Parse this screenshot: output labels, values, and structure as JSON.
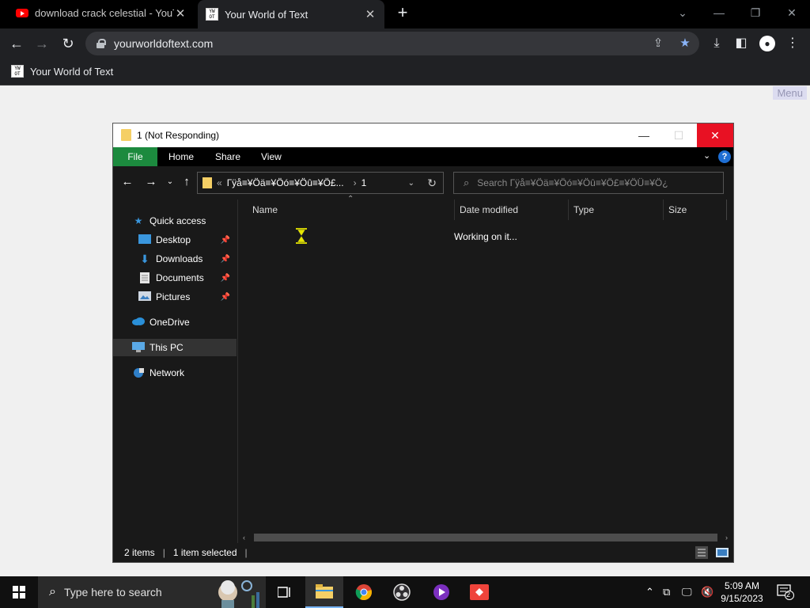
{
  "browser": {
    "tabs": [
      {
        "title": "download crack celestial - YouTube",
        "active": false
      },
      {
        "title": "Your World of Text",
        "active": true
      }
    ],
    "address": "yourworldoftext.com",
    "bookmarks": [
      {
        "label": "Your World of Text"
      }
    ]
  },
  "page": {
    "menu_label": "Menu"
  },
  "explorer": {
    "title": "1 (Not Responding)",
    "ribbon_tabs": [
      "File",
      "Home",
      "Share",
      "View"
    ],
    "address_overflow": "«",
    "address_path": [
      "Гÿå≡¥Öä≡¥Öó≡¥Öû≡¥Ö£...",
      "1"
    ],
    "search_placeholder": "Search Гÿå≡¥Öä≡¥Öó≡¥Öû≡¥Ö£≡¥ÖÜ≡¥Ö¿",
    "nav_items": [
      {
        "label": "Quick access",
        "icon": "star-icon",
        "pinned": false
      },
      {
        "label": "Desktop",
        "icon": "desktop-icon",
        "pinned": true
      },
      {
        "label": "Downloads",
        "icon": "download-arrow-icon",
        "pinned": true
      },
      {
        "label": "Documents",
        "icon": "document-icon",
        "pinned": true
      },
      {
        "label": "Pictures",
        "icon": "pictures-icon",
        "pinned": true
      },
      {
        "label": "OneDrive",
        "icon": "cloud-icon",
        "pinned": false
      },
      {
        "label": "This PC",
        "icon": "computer-icon",
        "pinned": false,
        "selected": true
      },
      {
        "label": "Network",
        "icon": "network-icon",
        "pinned": false
      }
    ],
    "columns": [
      "Name",
      "Date modified",
      "Type",
      "Size"
    ],
    "status_message": "Working on it...",
    "status_bar": {
      "items": "2 items",
      "selected": "1 item selected"
    }
  },
  "taskbar": {
    "search_placeholder": "Type here to search",
    "clock_time": "5:09 AM",
    "clock_date": "9/15/2023",
    "notification_count": "2"
  },
  "colors": {
    "file_tab": "#1c8a3e",
    "close_red": "#e81123",
    "folder_yellow": "#f5cf65",
    "explorer_bg": "#191919"
  }
}
